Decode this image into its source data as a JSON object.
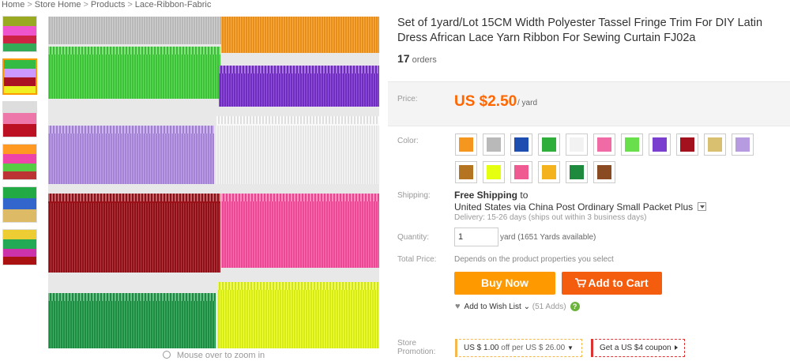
{
  "breadcrumb": [
    "Home",
    "Store Home",
    "Products",
    "Lace-Ribbon-Fabric"
  ],
  "breadcrumb_separator": ">",
  "product": {
    "title_line1": "Set of 1yard/Lot 15CM Width Polyester Tassel Fringe Trim For DIY Latin",
    "title_line2": "Dress African Lace Yarn Ribbon For Sewing Curtain FJ02a",
    "orders_count": "17",
    "orders_label": "orders"
  },
  "price": {
    "label": "Price:",
    "value": "US $2.50",
    "unit": "/ yard"
  },
  "color": {
    "label": "Color:",
    "swatches": [
      "#f5961e",
      "#b9b9b9",
      "#1e4fb0",
      "#2fae3c",
      "#f2f2f2",
      "#f06aa6",
      "#69e04b",
      "#7b3fcf",
      "#a3101e",
      "#d9c070",
      "#b79be0",
      "#b5741f",
      "#e6ff10",
      "#f05a93",
      "#f4b31d",
      "#1d8a3d",
      "#8a4a22"
    ]
  },
  "shipping": {
    "label": "Shipping:",
    "free_text": "Free Shipping",
    "to_text": "to",
    "route": "United States via China Post Ordinary Small Packet Plus",
    "delivery": "Delivery: 15-26 days (ships out within 3 business days)"
  },
  "quantity": {
    "label": "Quantity:",
    "value": "1",
    "available": "yard (1651 Yards available)"
  },
  "total": {
    "label": "Total Price:",
    "text": "Depends on the product properties you select"
  },
  "actions": {
    "buy_now": "Buy Now",
    "add_to_cart": "Add to Cart",
    "wishlist": "Add to Wish List",
    "wishlist_count": "(51 Adds)"
  },
  "promotion": {
    "label_line1": "Store",
    "label_line2": "Promotion:",
    "coupon1_prefix": "US $ 1.00",
    "coupon1_suffix": "off per US $ 26.00",
    "coupon2": "Get a US $4 coupon"
  },
  "zoom_hint": "Mouse over to zoom in",
  "icons": {
    "zoom": "magnifier-icon",
    "cart": "cart-icon",
    "heart": "heart-icon",
    "help": "help-icon"
  }
}
